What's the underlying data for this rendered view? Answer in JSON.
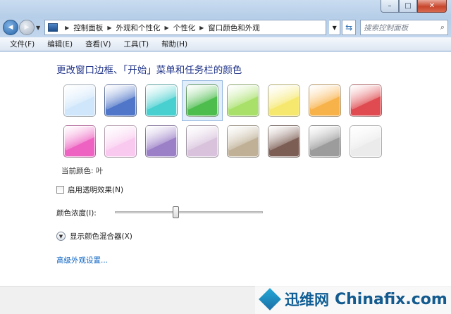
{
  "window": {
    "minimize_glyph": "–",
    "maximize_glyph": "□",
    "close_glyph": "✕"
  },
  "nav": {
    "back_glyph": "◀",
    "forward_glyph": "▶",
    "breadcrumbs": [
      "控制面板",
      "外观和个性化",
      "个性化",
      "窗口颜色和外观"
    ],
    "search_placeholder": "搜索控制面板"
  },
  "menu": [
    "文件(F)",
    "编辑(E)",
    "查看(V)",
    "工具(T)",
    "帮助(H)"
  ],
  "page": {
    "heading": "更改窗口边框、「开始」菜单和任务栏的颜色",
    "current_color_label": "当前颜色:",
    "current_color_value": "叶",
    "transparency_label": "启用透明效果(N)",
    "transparency_checked": false,
    "intensity_label": "颜色浓度(I):",
    "intensity_fraction": 0.41,
    "mixer_label": "显示颜色混合器(X)",
    "advanced_link": "高级外观设置..."
  },
  "swatches": [
    {
      "name": "sky",
      "color": "#cfe6fb",
      "selected": false
    },
    {
      "name": "twilight",
      "color": "#4f76c8",
      "selected": false
    },
    {
      "name": "sea",
      "color": "#48cfd0",
      "selected": false
    },
    {
      "name": "leaf",
      "color": "#4dbd4e",
      "selected": true
    },
    {
      "name": "lime",
      "color": "#a8e06a",
      "selected": false
    },
    {
      "name": "lemon",
      "color": "#f6e86e",
      "selected": false
    },
    {
      "name": "pumpkin",
      "color": "#f8b24a",
      "selected": false
    },
    {
      "name": "blush",
      "color": "#df4b50",
      "selected": false
    },
    {
      "name": "fuchsia",
      "color": "#ee63c2",
      "selected": false
    },
    {
      "name": "pink",
      "color": "#f9c9ef",
      "selected": false
    },
    {
      "name": "violet",
      "color": "#9b7fc7",
      "selected": false
    },
    {
      "name": "lavender",
      "color": "#d8c2dc",
      "selected": false
    },
    {
      "name": "taupe",
      "color": "#bfb096",
      "selected": false
    },
    {
      "name": "chocolate",
      "color": "#7d5e54",
      "selected": false
    },
    {
      "name": "slate",
      "color": "#9c9c9c",
      "selected": false
    },
    {
      "name": "frost",
      "color": "#ebebeb",
      "selected": false
    }
  ],
  "watermark": {
    "cn": "迅维网",
    "en": "Chinafix.com"
  }
}
